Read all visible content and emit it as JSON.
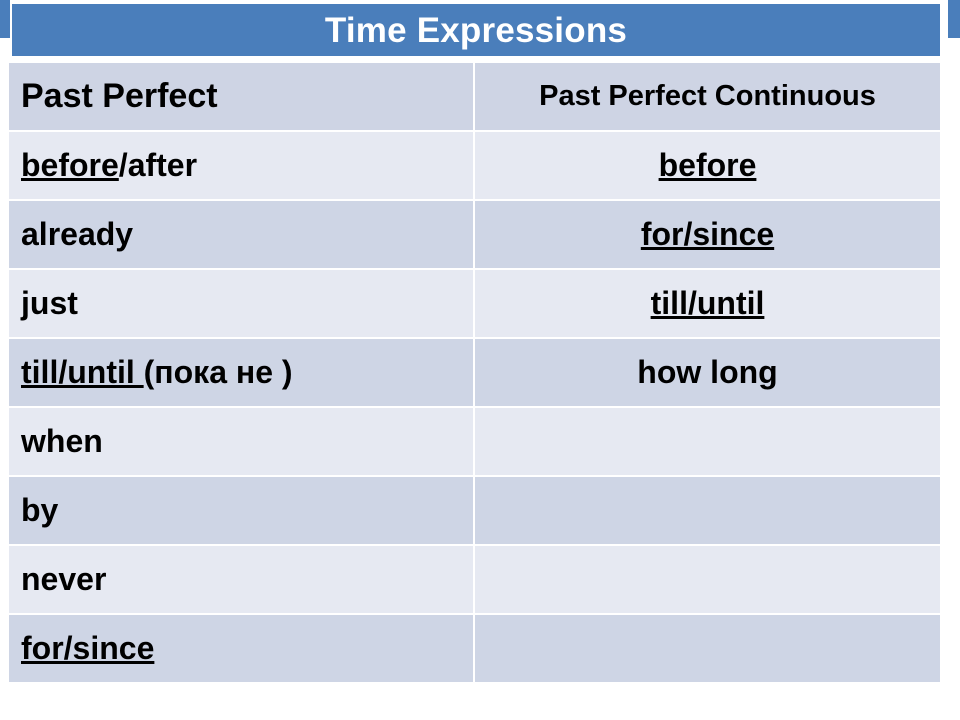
{
  "slide": {
    "title": "Time Expressions",
    "title_background_color": "#4a7ebb",
    "title_text_color": "#ffffff"
  },
  "table": {
    "header": {
      "col1": "Past Perfect",
      "col2": "Past Perfect Continuous"
    },
    "colors": {
      "header_row": "#ced4e4",
      "band_light": "#e6e9f2",
      "band_dark": "#ced5e5",
      "gridline": "#ffffff"
    },
    "rows": [
      {
        "col1_underlined": "before",
        "col1_plain": "/after",
        "col2_underlined": "before",
        "col2_plain": ""
      },
      {
        "col1_underlined": "",
        "col1_plain": "already",
        "col2_underlined": "for/since",
        "col2_plain": ""
      },
      {
        "col1_underlined": "",
        "col1_plain": "just",
        "col2_underlined": "till/until",
        "col2_plain": ""
      },
      {
        "col1_underlined": "till/until ",
        "col1_plain": "(пока не )",
        "col2_underlined": "",
        "col2_plain": "how long"
      },
      {
        "col1_underlined": "",
        "col1_plain": "when",
        "col2_underlined": "",
        "col2_plain": ""
      },
      {
        "col1_underlined": "",
        "col1_plain": "by",
        "col2_underlined": "",
        "col2_plain": ""
      },
      {
        "col1_underlined": "",
        "col1_plain": "never",
        "col2_underlined": "",
        "col2_plain": ""
      },
      {
        "col1_underlined": "for/since",
        "col1_plain": "",
        "col2_underlined": "",
        "col2_plain": ""
      }
    ]
  }
}
